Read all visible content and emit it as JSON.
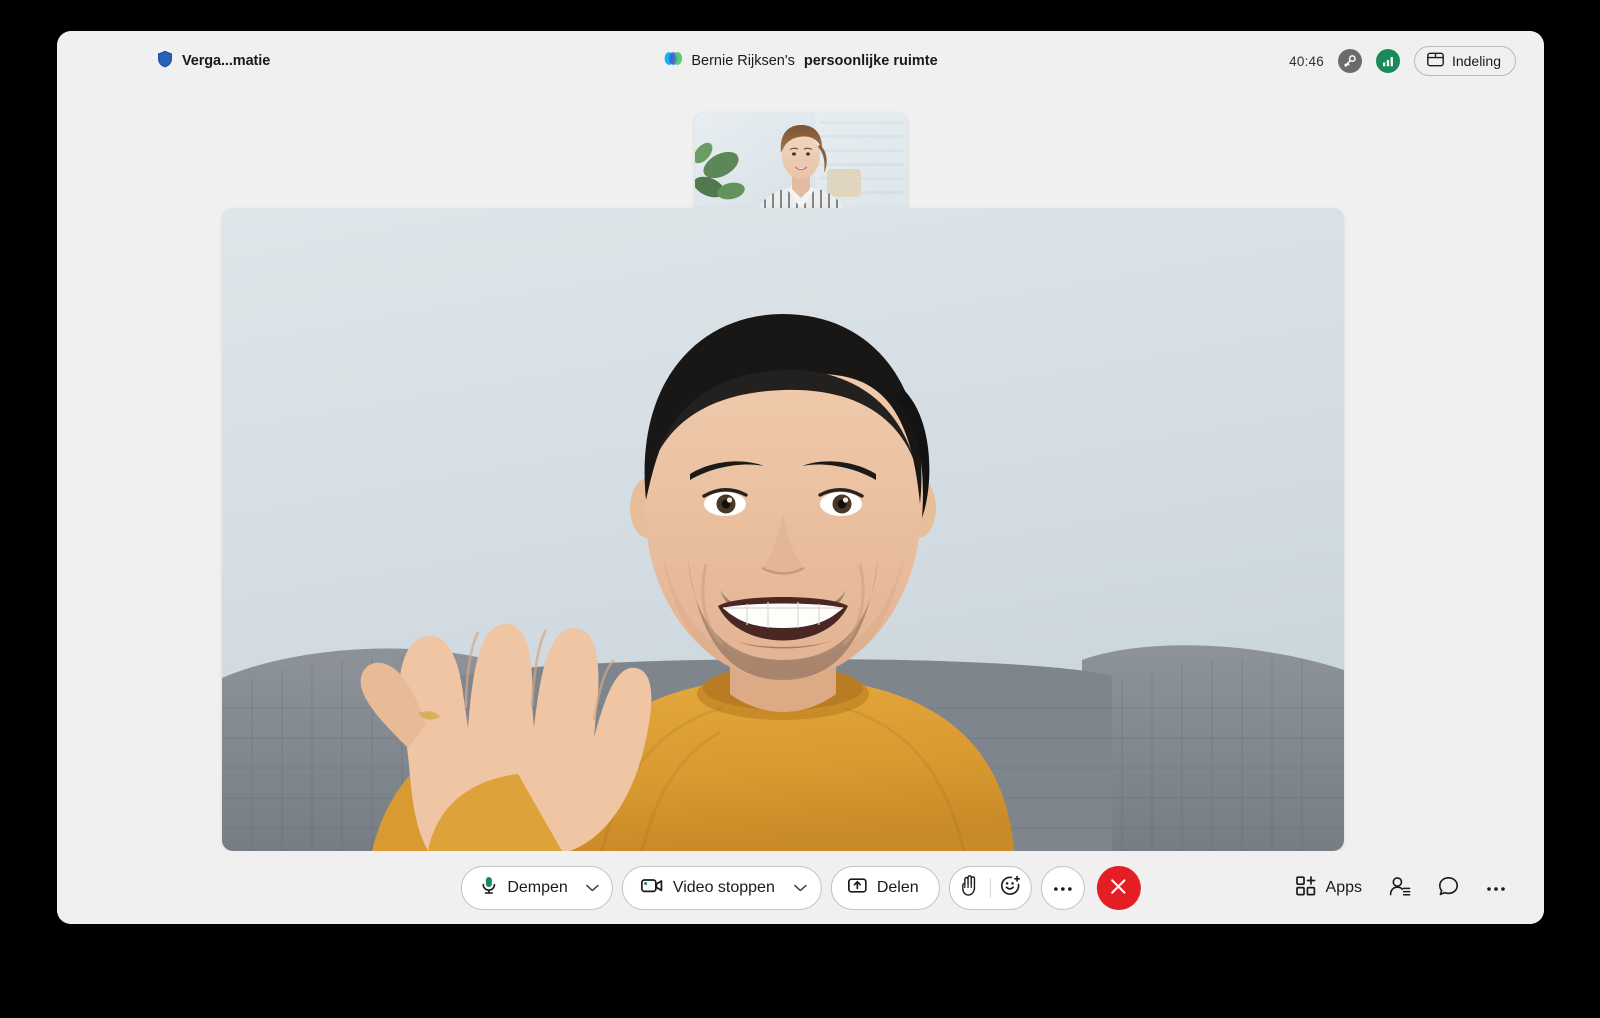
{
  "window": {
    "background_color": "#f0f0f0",
    "page_background": "#000000"
  },
  "header": {
    "shield_icon": "shield-icon",
    "meeting_label": "Verga...matie",
    "space_logo_icon": "webex-logo-icon",
    "space_owner": "Bernie Rijksen's",
    "space_suffix": "persoonlijke ruimte",
    "timer": "40:46",
    "encryption_icon": "key-icon",
    "encryption_color": "#6b6b6b",
    "network_icon": "signal-bars-icon",
    "network_color": "#1a8a5a",
    "layout_icon": "layout-grid-icon",
    "layout_label": "Indeling"
  },
  "selfview": {
    "name": "self-view-thumbnail",
    "drag_handle": "drag-handle"
  },
  "stage": {
    "name": "active-speaker-video"
  },
  "controls": {
    "mute": {
      "label": "Dempen",
      "icon": "microphone-icon",
      "icon_color": "#1a8a5a",
      "chevron": "chevron-down-icon"
    },
    "video": {
      "label": "Video stoppen",
      "icon": "camera-icon",
      "icon_color": "#1a8a5a",
      "chevron": "chevron-down-icon"
    },
    "share": {
      "label": "Delen",
      "icon": "share-screen-icon"
    },
    "raise_hand": {
      "icon": "raise-hand-icon"
    },
    "reactions": {
      "icon": "emoji-reaction-icon"
    },
    "more": {
      "icon": "ellipsis-icon"
    },
    "end_call": {
      "icon": "close-icon",
      "color": "#e31e24"
    },
    "apps": {
      "label": "Apps",
      "icon": "apps-grid-plus-icon"
    },
    "participants": {
      "icon": "participants-icon"
    },
    "chat": {
      "icon": "chat-bubble-icon"
    },
    "overflow": {
      "icon": "ellipsis-icon"
    }
  }
}
